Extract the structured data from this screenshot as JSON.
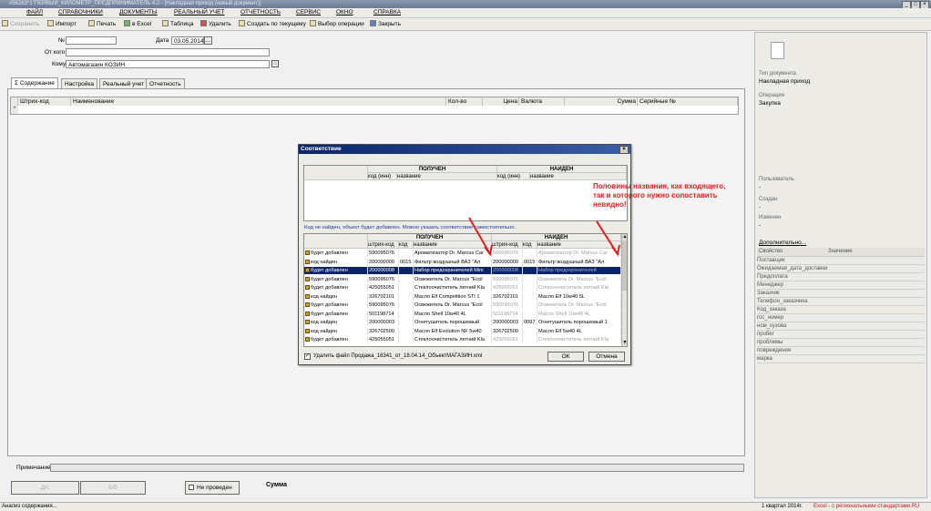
{
  "window": {
    "title": "#56263*1\"ПЕРВЫЙ_КИЛОМЕТР_ПРЕДПРИНИМАТЕЛЬ 4.2 - [Накладная приход (новый документ)]"
  },
  "menu": [
    "ФАЙЛ",
    "СПРАВОЧНИКИ",
    "ДОКУМЕНТЫ",
    "РЕАЛЬНЫЙ УЧЕТ",
    "ОТЧЕТНОСТЬ",
    "СЕРВИС",
    "ОКНО",
    "СПРАВКА"
  ],
  "toolbar": {
    "save": "Сохранить",
    "import": "Импорт",
    "print": "Печать",
    "excel": "в Excel",
    "table": "Таблица",
    "delete": "Удалить",
    "create_by_current": "Создать по текущему",
    "select_operation": "Выбор операции",
    "close": "Закрыть"
  },
  "form": {
    "number_label": "№",
    "number_value": "",
    "date_label": "Дата",
    "date_value": "03.05.2014",
    "from_label": "От кого",
    "from_value": "",
    "to_label": "Кому",
    "to_value": "Автомагазин КОЗИН"
  },
  "tabs": [
    "Содержание",
    "Настройка",
    "Реальный учет",
    "Отчетность"
  ],
  "main_grid": {
    "columns": [
      "Штрих-код",
      "Наименование",
      "Кол-во",
      "Цена",
      "Валюта",
      "Сумма",
      "Серийные №"
    ]
  },
  "right_panel": {
    "doc_type_label": "Тип документа",
    "doc_type": "Накладная приход",
    "operation_label": "Операция",
    "operation": "Закупка",
    "users_label": "Пользователь",
    "users": "-",
    "created_label": "Создан",
    "created": "-",
    "changed_label": "Изменен",
    "changed": "-",
    "additional_label": "Дополнительно...",
    "props_header": [
      "Свойство",
      "Значение"
    ],
    "props": [
      "Поставщик",
      "Ожидаемая_дата_доставки",
      "Предоплата",
      "Менеджер",
      "Заказчик",
      "Телефон_заказчика",
      "Код_заказа",
      "гос_номер",
      "ном_кузова",
      "пробег",
      "проблемы",
      "повреждения",
      "марка"
    ]
  },
  "dialog": {
    "title": "Соответствие",
    "close_glyph": "×",
    "top_header_received": "ПОЛУЧЕН",
    "top_header_found": "НАЙДЕН",
    "top_subheaders": [
      "код (инн)",
      "название",
      "код (инн)",
      "название"
    ],
    "info_text": "Код не найден, объект будет добавлен. Можно указать соответствие самостоятельно.",
    "grid_header_received": "ПОЛУЧЕН",
    "grid_header_found": "НАЙДЕН",
    "grid_subheaders": [
      "штрих-код",
      "код",
      "название",
      "штрих-код",
      "код",
      "название"
    ],
    "rows": [
      {
        "status": "будет добавлен",
        "bc": "590095076",
        "code": "",
        "name": "Ароматизатор Dr. Marcus Car",
        "fbc": "590095076",
        "fcode": "",
        "fname": "Ароматизатор Dr. Marcus Car",
        "found": false
      },
      {
        "status": "код найден",
        "bc": "200000000",
        "code": "0015",
        "name": "Фильтр воздушный ВАЗ \"Ал",
        "fbc": "200000000",
        "fcode": "0015",
        "fname": "Фильтр воздушный ВАЗ \"Ал",
        "found": true
      },
      {
        "status": "будет добавлен",
        "bc": "200000008",
        "code": "",
        "name": "Набор предохранителей Mini",
        "fbc": "200000008",
        "fcode": "",
        "fname": "Набор предохранителей",
        "found": false,
        "selected": true
      },
      {
        "status": "будет добавлен",
        "bc": "590095076",
        "code": "",
        "name": "Освежитель Dr. Marcus \"Ecol",
        "fbc": "590095076",
        "fcode": "",
        "fname": "Освежитель Dr. Marcus \"Ecol",
        "found": false
      },
      {
        "status": "будет добавлен",
        "bc": "425055051",
        "code": "",
        "name": "Стеклоочиститель летний Kla",
        "fbc": "425055051",
        "fcode": "",
        "fname": "Стеклоочиститель летний Kla",
        "found": false
      },
      {
        "status": "код найден",
        "bc": "326702101",
        "code": "",
        "name": "Масло Elf Competition STI 1",
        "fbc": "326702101",
        "fcode": "",
        "fname": "Масло Elf 10w40 5L",
        "found": true
      },
      {
        "status": "будет добавлен",
        "bc": "590095076",
        "code": "",
        "name": "Освежитель Dr. Marcus \"Ecol",
        "fbc": "590095076",
        "fcode": "",
        "fname": "Освежитель Dr. Marcus \"Ecol",
        "found": false
      },
      {
        "status": "будет добавлен",
        "bc": "501198714",
        "code": "",
        "name": "Масло Shell 10w40 4L",
        "fbc": "501198714",
        "fcode": "",
        "fname": "Масло Shell 10w40 4L",
        "found": false
      },
      {
        "status": "код найден",
        "bc": "200000003",
        "code": "",
        "name": "Огнетушитель порошковый",
        "fbc": "200000003",
        "fcode": "0097",
        "fname": "Огнетушитель порошковый 1",
        "found": true
      },
      {
        "status": "код найден",
        "bc": "326702500",
        "code": "",
        "name": "Масло Elf Evolution NF 5w40",
        "fbc": "326702500",
        "fcode": "",
        "fname": "Масло Elf 5w40 4L",
        "found": true
      },
      {
        "status": "будет добавлен",
        "bc": "425055051",
        "code": "",
        "name": "Стеклоочиститель летний Kla",
        "fbc": "425055051",
        "fcode": "",
        "fname": "Стеклоочиститель летний Kla",
        "found": false
      }
    ],
    "delete_file_label": "Удалить файл Продажа_16341_от_18.04.14_ОбъектМАГАЗИН.xml",
    "ok": "ОК",
    "cancel": "Отмена"
  },
  "annotation": "Половины названия, как входящего, так и которого нужно сопоставить невидно!",
  "bottom": {
    "note_label": "Примечание",
    "btn1": "Д/с",
    "btn2": "Б/б",
    "not_posted": "Не проведен",
    "sum_label": "Сумма"
  },
  "statusbar": {
    "left": "Анализ содержания...",
    "period": "1 квартал 2014г.",
    "right": "Excel - с региональными стандартами.RU"
  },
  "colors": {
    "title_bar": "#6b7a94",
    "dialog_title": "#0a246a",
    "selection": "#0a246a",
    "annotation": "#e02020"
  }
}
